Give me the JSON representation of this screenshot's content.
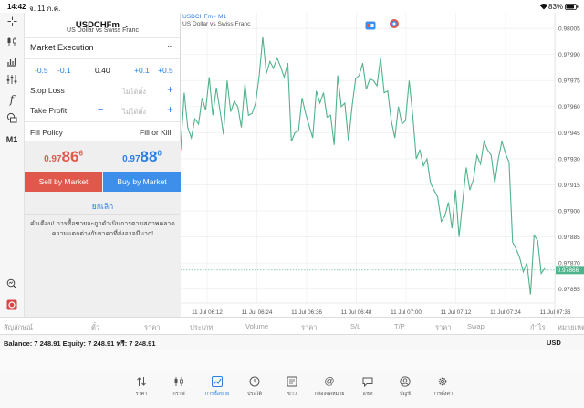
{
  "status_bar": {
    "time": "14:42",
    "date": "จ. 11 ก.ค.",
    "battery": "83%"
  },
  "symbol": {
    "name": "USDCHFm",
    "description": "US Dollar vs Swiss Franc"
  },
  "order": {
    "type": "Market Execution",
    "volume_steps": {
      "minus_big": "-0.5",
      "minus_small": "-0.1",
      "value": "0.40",
      "plus_small": "+0.1",
      "plus_big": "+0.5"
    },
    "stop_loss": {
      "label": "Stop Loss",
      "minus": "−",
      "value": "ไม่ได้ตั้ง",
      "plus": "+"
    },
    "take_profit": {
      "label": "Take Profit",
      "minus": "−",
      "value": "ไม่ได้ตั้ง",
      "plus": "+"
    },
    "fill_policy": {
      "label": "Fill Policy",
      "value": "Fill or Kill"
    },
    "sell_price": {
      "prefix": "0.97",
      "big": "86",
      "sup": "6"
    },
    "buy_price": {
      "prefix": "0.97",
      "big": "88",
      "sup": "0"
    },
    "sell_button": "Sell by Market",
    "buy_button": "Buy by Market",
    "cancel": "ยกเลิก",
    "warning": "คำเตือน! การซื้อขายจะถูกดำเนินการตามสภาพตลาด ความแตกต่างกับราคาที่ส่งอาจมีมาก!"
  },
  "left_toolbar": {
    "timeframe": "M1"
  },
  "chart_header": {
    "title": "USDCHFm • M1",
    "subtitle": "US Dollar vs Swiss Franc"
  },
  "chart_data": {
    "type": "line",
    "y_ticks": [
      "0.98005",
      "0.97990",
      "0.97975",
      "0.97960",
      "0.97945",
      "0.97930",
      "0.97915",
      "0.97900",
      "0.97885",
      "0.97870",
      "0.97855"
    ],
    "x_ticks": [
      "11 Jul 06:12",
      "11 Jul 06:24",
      "11 Jul 06:36",
      "11 Jul 06:48",
      "11 Jul 07:00",
      "11 Jul 07:12",
      "11 Jul 07:24",
      "11 Jul 07:36"
    ],
    "ylim": [
      0.97847,
      0.98014
    ],
    "current_price": "0.97866",
    "current_price_value": 0.97866,
    "values": [
      0.97935,
      0.97968,
      0.97948,
      0.97942,
      0.97953,
      0.9795,
      0.97965,
      0.97958,
      0.97977,
      0.97955,
      0.97971,
      0.97958,
      0.97944,
      0.97975,
      0.97957,
      0.97963,
      0.9796,
      0.97948,
      0.97973,
      0.97955,
      0.97956,
      0.97962,
      0.97978,
      0.98,
      0.97979,
      0.97986,
      0.97982,
      0.97988,
      0.97983,
      0.97977,
      0.97985,
      0.9794,
      0.97945,
      0.97946,
      0.97965,
      0.97956,
      0.97949,
      0.97942,
      0.97969,
      0.97962,
      0.97968,
      0.97954,
      0.97955,
      0.97938,
      0.97978,
      0.9796,
      0.97962,
      0.9794,
      0.9796,
      0.97976,
      0.97978,
      0.97985,
      0.9797,
      0.97976,
      0.97975,
      0.97972,
      0.97988,
      0.97968,
      0.97969,
      0.97952,
      0.97942,
      0.9796,
      0.9795,
      0.97952,
      0.97975,
      0.97955,
      0.9793,
      0.97935,
      0.97926,
      0.9793,
      0.97916,
      0.97912,
      0.97908,
      0.97894,
      0.97897,
      0.97905,
      0.9789,
      0.97912,
      0.97885,
      0.97905,
      0.97925,
      0.97912,
      0.97918,
      0.97932,
      0.97927,
      0.9794,
      0.97935,
      0.97932,
      0.97916,
      0.9793,
      0.9794,
      0.97933,
      0.97928,
      0.97882,
      0.97878,
      0.97873,
      0.97865,
      0.9787,
      0.97852,
      0.97886,
      0.97883,
      0.97864,
      0.97867
    ]
  },
  "positions_header": [
    "สัญลักษณ์",
    "ตั๋ว",
    "ราคา",
    "ประเภท",
    "Volume",
    "ราคา",
    "S/L",
    "T/P",
    "ราคา",
    "Swap",
    "กำไร",
    "หมายเหตุ"
  ],
  "balance": {
    "text": "Balance: 7 248.91 Equity: 7 248.91 ฟรี: 7 248.91",
    "currency": "USD"
  },
  "tabs": [
    {
      "name": "quotes",
      "label": "ราคา",
      "icon": "updown-arrows-icon"
    },
    {
      "name": "charts",
      "label": "กราฟ",
      "icon": "candles-icon"
    },
    {
      "name": "trade",
      "label": "การซื้อขาย",
      "icon": "trade-chart-icon",
      "active": true
    },
    {
      "name": "history",
      "label": "ประวัติ",
      "icon": "history-icon"
    },
    {
      "name": "news",
      "label": "ข่าว",
      "icon": "news-icon"
    },
    {
      "name": "mailbox",
      "label": "กล่องจดหมาย",
      "icon": "at-icon"
    },
    {
      "name": "chat",
      "label": "แชท",
      "icon": "chat-icon"
    },
    {
      "name": "accounts",
      "label": "บัญชี",
      "icon": "account-icon"
    },
    {
      "name": "settings",
      "label": "การตั้งค่า",
      "icon": "gear-icon"
    }
  ],
  "colors": {
    "accent": "#2a7de1",
    "sell": "#e0584b",
    "buy": "#3d8fea",
    "line": "#4fb38c"
  }
}
